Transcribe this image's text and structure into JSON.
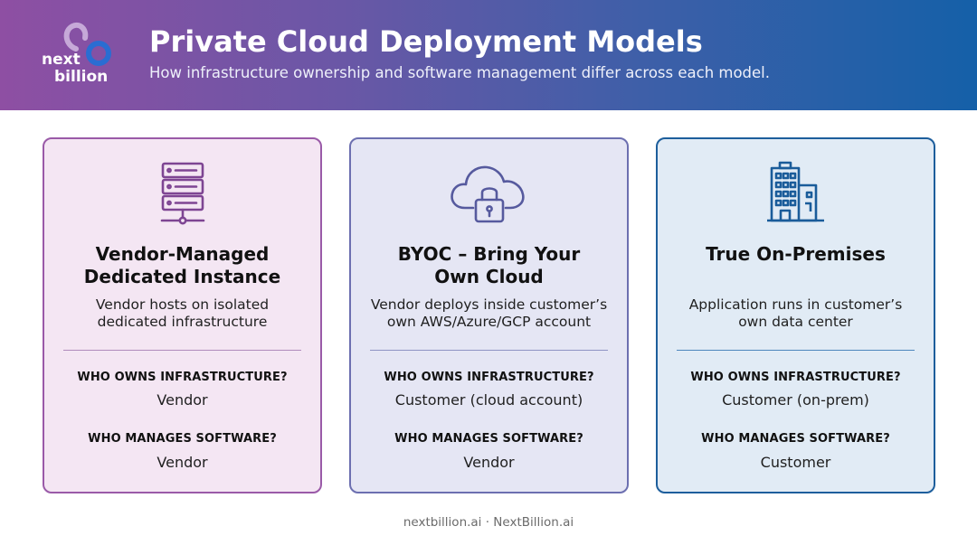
{
  "header": {
    "logo_line1": "next",
    "logo_line2": "billion",
    "title": "Private Cloud Deployment Models",
    "subtitle": "How infrastructure ownership and software management differ across each model."
  },
  "colors": {
    "header_gradient": [
      "#8e4fa3",
      "#1560a8"
    ],
    "card1_accent": "#9a5aa8",
    "card2_accent": "#6c6fb0",
    "card3_accent": "#1d5e9c"
  },
  "cards": [
    {
      "icon": "server-rack-icon",
      "title_line1": "Vendor-Managed",
      "title_line2": "Dedicated Instance",
      "desc_line1": "Vendor hosts on isolated",
      "desc_line2": "dedicated infrastructure",
      "q1": "WHO OWNS INFRASTRUCTURE?",
      "a1": "Vendor",
      "q2": "WHO MANAGES SOFTWARE?",
      "a2": "Vendor"
    },
    {
      "icon": "cloud-lock-icon",
      "title_line1": "BYOC – Bring Your",
      "title_line2": "Own Cloud",
      "desc_line1": "Vendor deploys inside customer’s",
      "desc_line2": "own AWS/Azure/GCP account",
      "q1": "WHO OWNS INFRASTRUCTURE?",
      "a1": "Customer (cloud account)",
      "q2": "WHO MANAGES SOFTWARE?",
      "a2": "Vendor"
    },
    {
      "icon": "office-building-icon",
      "title_line1": "True On-Premises",
      "title_line2": "",
      "desc_line1": "Application runs in customer’s",
      "desc_line2": "own data center",
      "q1": "WHO OWNS INFRASTRUCTURE?",
      "a1": "Customer (on-prem)",
      "q2": "WHO MANAGES SOFTWARE?",
      "a2": "Customer"
    }
  ],
  "footer": "nextbillion.ai · NextBillion.ai"
}
